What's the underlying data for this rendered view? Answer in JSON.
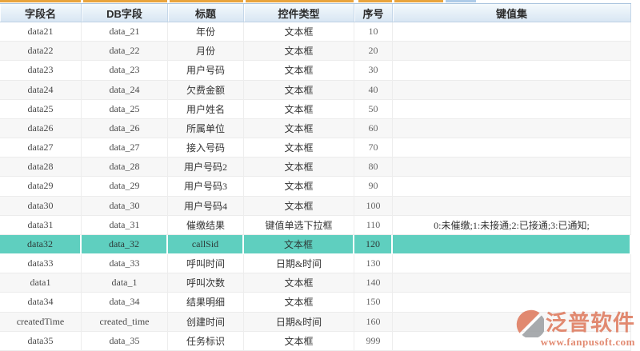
{
  "colors": {
    "highlight_row": "#5FCFBF",
    "accent_orange": "#E9A43D",
    "accent_blue": "#AECBE8",
    "watermark_text": "#DF7A5E"
  },
  "table": {
    "columns": [
      {
        "key": "field",
        "label": "字段名"
      },
      {
        "key": "db",
        "label": "DB字段"
      },
      {
        "key": "title",
        "label": "标题"
      },
      {
        "key": "control",
        "label": "控件类型"
      },
      {
        "key": "seq",
        "label": "序号"
      },
      {
        "key": "keyset",
        "label": "键值集"
      }
    ],
    "rows": [
      {
        "field": "data21",
        "db": "data_21",
        "title": "年份",
        "control": "文本框",
        "seq": "10",
        "keyset": "",
        "highlighted": false
      },
      {
        "field": "data22",
        "db": "data_22",
        "title": "月份",
        "control": "文本框",
        "seq": "20",
        "keyset": "",
        "highlighted": false
      },
      {
        "field": "data23",
        "db": "data_23",
        "title": "用户号码",
        "control": "文本框",
        "seq": "30",
        "keyset": "",
        "highlighted": false
      },
      {
        "field": "data24",
        "db": "data_24",
        "title": "欠费金额",
        "control": "文本框",
        "seq": "40",
        "keyset": "",
        "highlighted": false
      },
      {
        "field": "data25",
        "db": "data_25",
        "title": "用户姓名",
        "control": "文本框",
        "seq": "50",
        "keyset": "",
        "highlighted": false
      },
      {
        "field": "data26",
        "db": "data_26",
        "title": "所属单位",
        "control": "文本框",
        "seq": "60",
        "keyset": "",
        "highlighted": false
      },
      {
        "field": "data27",
        "db": "data_27",
        "title": "接入号码",
        "control": "文本框",
        "seq": "70",
        "keyset": "",
        "highlighted": false
      },
      {
        "field": "data28",
        "db": "data_28",
        "title": "用户号码2",
        "control": "文本框",
        "seq": "80",
        "keyset": "",
        "highlighted": false
      },
      {
        "field": "data29",
        "db": "data_29",
        "title": "用户号码3",
        "control": "文本框",
        "seq": "90",
        "keyset": "",
        "highlighted": false
      },
      {
        "field": "data30",
        "db": "data_30",
        "title": "用户号码4",
        "control": "文本框",
        "seq": "100",
        "keyset": "",
        "highlighted": false
      },
      {
        "field": "data31",
        "db": "data_31",
        "title": "催缴结果",
        "control": "键值单选下拉框",
        "seq": "110",
        "keyset": "0:未催缴;1:未接通;2:已接通;3:已通知;",
        "highlighted": false
      },
      {
        "field": "data32",
        "db": "data_32",
        "title": "callSid",
        "control": "文本框",
        "seq": "120",
        "keyset": "",
        "highlighted": true
      },
      {
        "field": "data33",
        "db": "data_33",
        "title": "呼叫时间",
        "control": "日期&时间",
        "seq": "130",
        "keyset": "",
        "highlighted": false
      },
      {
        "field": "data1",
        "db": "data_1",
        "title": "呼叫次数",
        "control": "文本框",
        "seq": "140",
        "keyset": "",
        "highlighted": false
      },
      {
        "field": "data34",
        "db": "data_34",
        "title": "结果明细",
        "control": "文本框",
        "seq": "150",
        "keyset": "",
        "highlighted": false
      },
      {
        "field": "createdTime",
        "db": "created_time",
        "title": "创建时间",
        "control": "日期&时间",
        "seq": "160",
        "keyset": "",
        "highlighted": false
      },
      {
        "field": "data35",
        "db": "data_35",
        "title": "任务标识",
        "control": "文本框",
        "seq": "999",
        "keyset": "",
        "highlighted": false
      }
    ]
  },
  "watermark": {
    "brand": "泛普软件",
    "url": "www.fanpusoft.com"
  }
}
